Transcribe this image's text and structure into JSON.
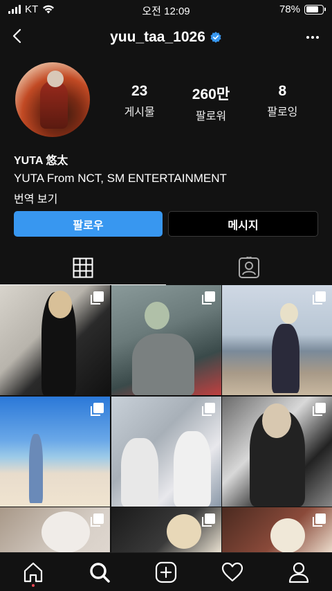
{
  "status_bar": {
    "carrier": "KT",
    "time": "오전 12:09",
    "battery": "78%",
    "battery_level": 0.78
  },
  "header": {
    "username": "yuu_taa_1026",
    "back_icon": "chevron-left-icon",
    "more_icon": "more-horizontal-icon",
    "verified_color": "#3897f0"
  },
  "profile": {
    "stats": [
      {
        "value": "23",
        "label": "게시물"
      },
      {
        "value": "260만",
        "label": "팔로워"
      },
      {
        "value": "8",
        "label": "팔로잉"
      }
    ],
    "name": "YUTA 悠太",
    "bio": "YUTA From NCT, SM ENTERTAINMENT",
    "translate": "번역 보기"
  },
  "actions": {
    "follow_label": "팔로우",
    "message_label": "메시지",
    "follow_color": "#3897f0"
  },
  "tabs": [
    {
      "icon": "grid-icon",
      "active": true
    },
    {
      "icon": "tagged-person-icon",
      "active": false
    }
  ],
  "posts_count_visible": 9,
  "bottom_nav": [
    "home-icon",
    "search-icon",
    "add-post-icon",
    "heart-icon",
    "profile-icon"
  ]
}
